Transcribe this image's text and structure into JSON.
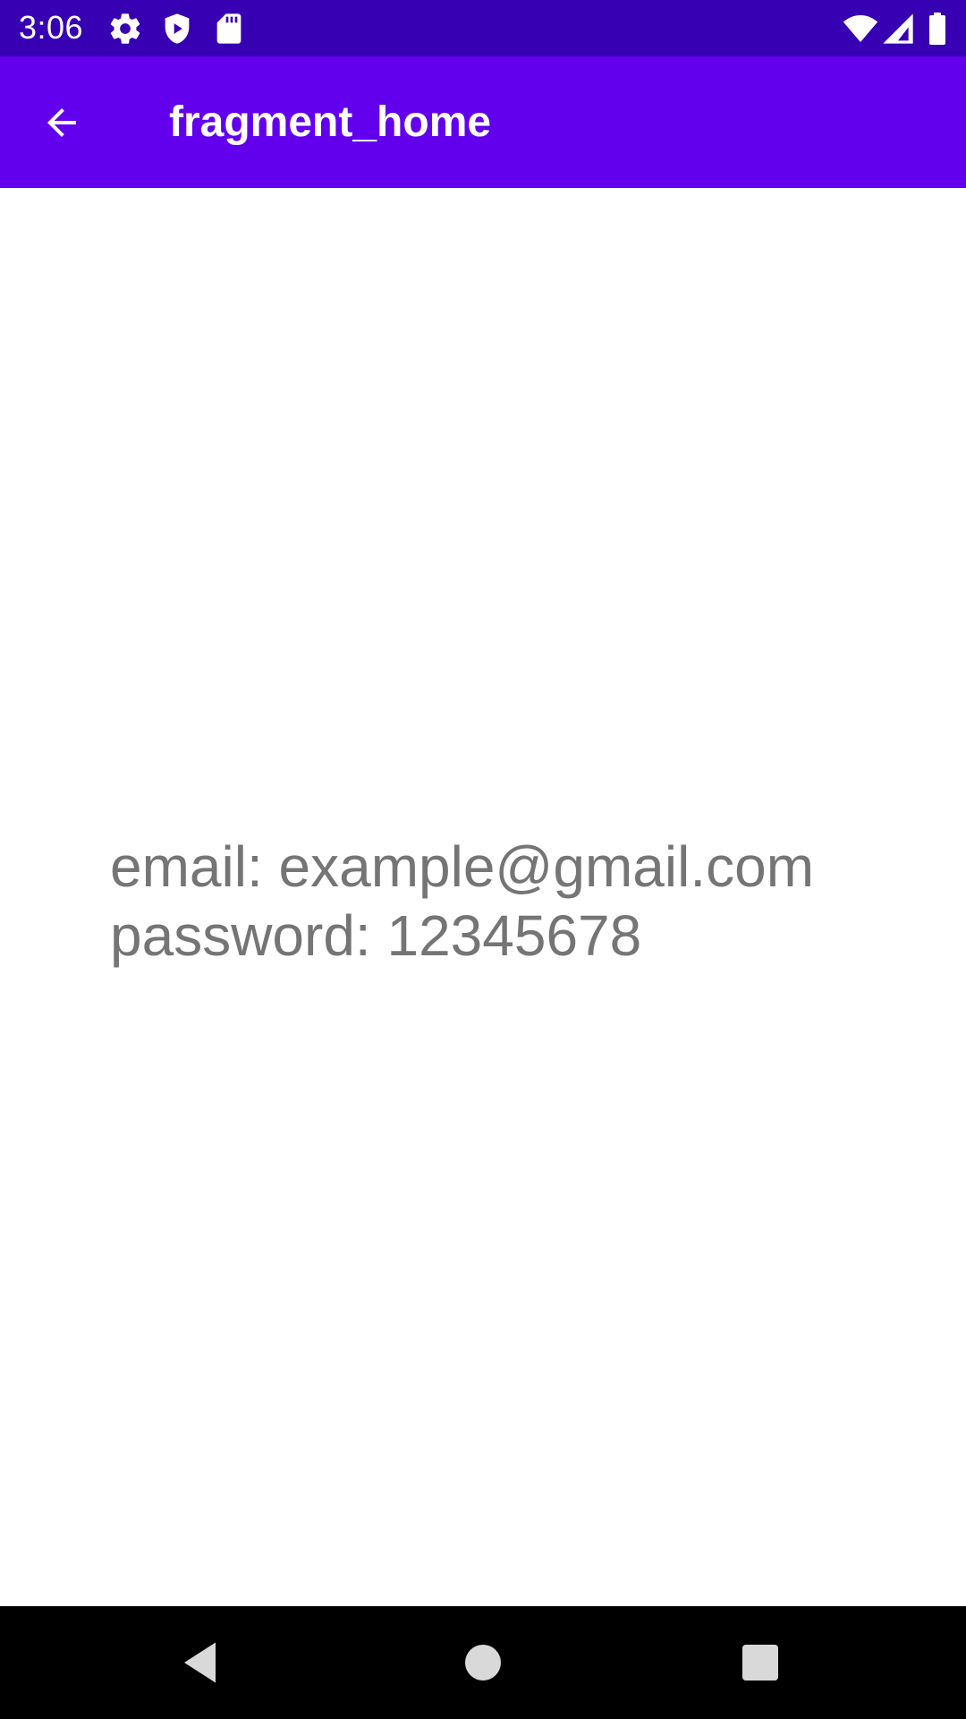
{
  "status_bar": {
    "time": "3:06",
    "icons": [
      "gear-icon",
      "shield-play-icon",
      "sd-card-icon",
      "wifi-icon",
      "cellular-signal-icon",
      "battery-icon"
    ],
    "background": "#3700B3"
  },
  "app_bar": {
    "title": "fragment_home",
    "back_icon": "arrow-back-icon",
    "background": "#6200EE"
  },
  "content": {
    "email_line": "email: example@gmail.com",
    "password_line": "password: 12345678",
    "text_color": "#757575"
  },
  "nav_bar": {
    "buttons": [
      "back-triangle-icon",
      "home-circle-icon",
      "recents-square-icon"
    ],
    "background": "#000000"
  }
}
